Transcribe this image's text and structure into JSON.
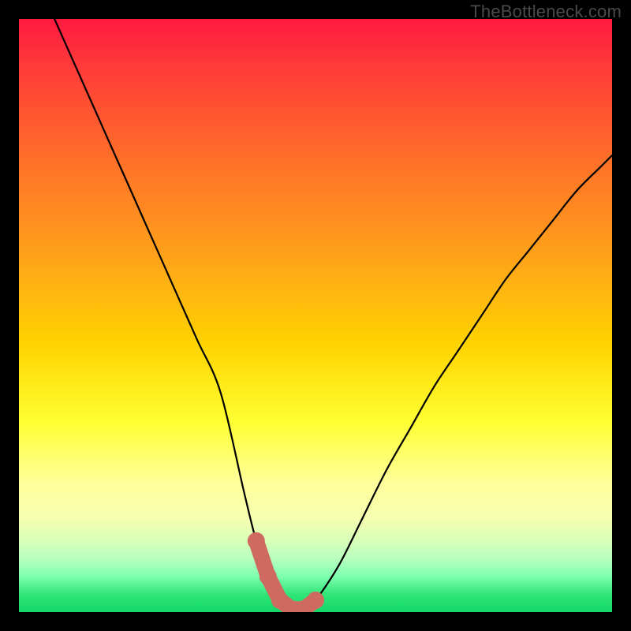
{
  "watermark": "TheBottleneck.com",
  "colors": {
    "background": "#000000",
    "curve": "#000000",
    "bump": "#cf6a60"
  },
  "chart_data": {
    "type": "line",
    "title": "",
    "xlabel": "",
    "ylabel": "",
    "xlim": [
      0,
      100
    ],
    "ylim": [
      0,
      100
    ],
    "grid": false,
    "legend": false,
    "series": [
      {
        "name": "bottleneck-curve",
        "x": [
          6,
          10,
          14,
          18,
          22,
          26,
          30,
          34,
          38,
          40,
          42,
          44,
          46,
          48,
          50,
          54,
          58,
          62,
          66,
          70,
          74,
          78,
          82,
          86,
          90,
          94,
          98,
          100
        ],
        "y": [
          100,
          91,
          82,
          73,
          64,
          55,
          46,
          37,
          20,
          12,
          6,
          2,
          0.5,
          0.5,
          2,
          8,
          16,
          24,
          31,
          38,
          44,
          50,
          56,
          61,
          66,
          71,
          75,
          77
        ]
      }
    ],
    "annotations": [
      {
        "name": "valley-bumps",
        "x_range": [
          38,
          50
        ],
        "y_range": [
          0,
          12
        ]
      }
    ],
    "background_gradient": {
      "type": "vertical",
      "stops": [
        {
          "pos": 0,
          "color": "#ff1a40"
        },
        {
          "pos": 22,
          "color": "#ff6a2a"
        },
        {
          "pos": 55,
          "color": "#ffd400"
        },
        {
          "pos": 78,
          "color": "#ffff99"
        },
        {
          "pos": 97,
          "color": "#31e576"
        },
        {
          "pos": 100,
          "color": "#11d868"
        }
      ]
    }
  }
}
